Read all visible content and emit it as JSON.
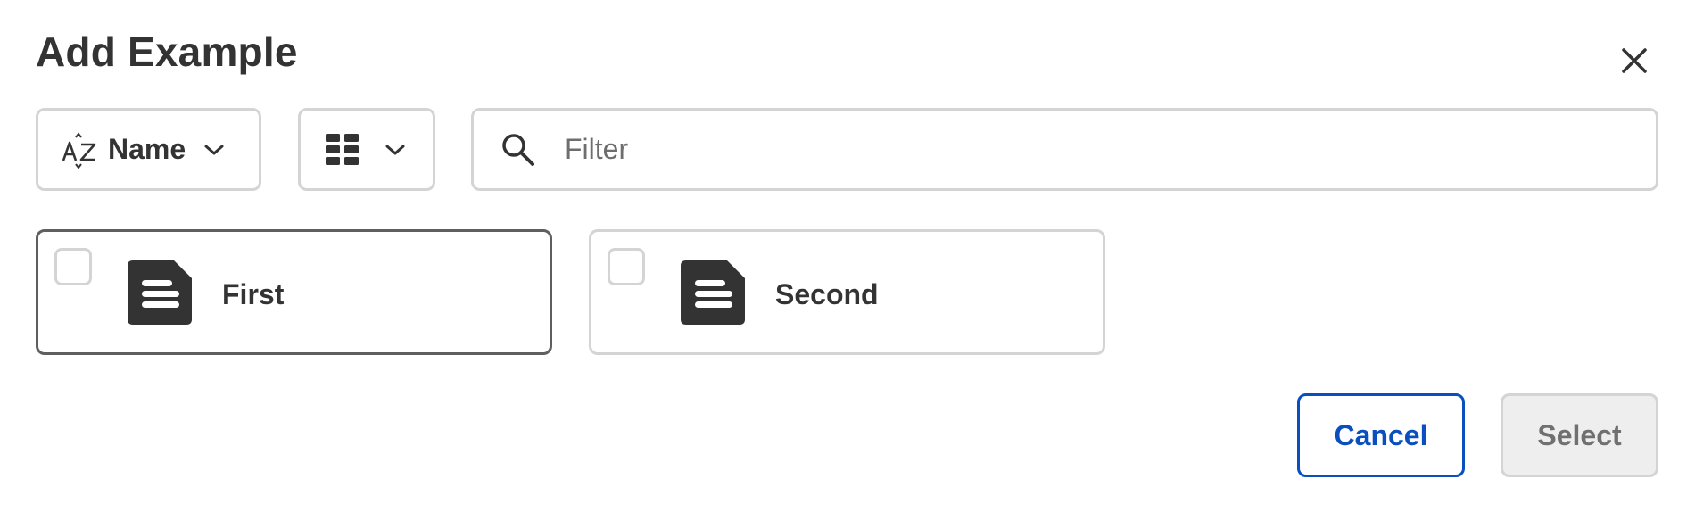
{
  "dialog": {
    "title": "Add Example"
  },
  "toolbar": {
    "sort_label": "Name",
    "filter_placeholder": "Filter"
  },
  "items": [
    {
      "label": "First",
      "checked": false
    },
    {
      "label": "Second",
      "checked": false
    }
  ],
  "footer": {
    "cancel_label": "Cancel",
    "select_label": "Select"
  },
  "colors": {
    "accent": "#0a4fbf",
    "text": "#333333",
    "border": "#d4d4d4",
    "disabled_bg": "#eeeeee"
  },
  "icons": {
    "close": "close-icon",
    "sort": "sort-az-icon",
    "view": "grid-view-icon",
    "chevron": "chevron-down-icon",
    "search": "search-icon",
    "file": "document-icon"
  }
}
